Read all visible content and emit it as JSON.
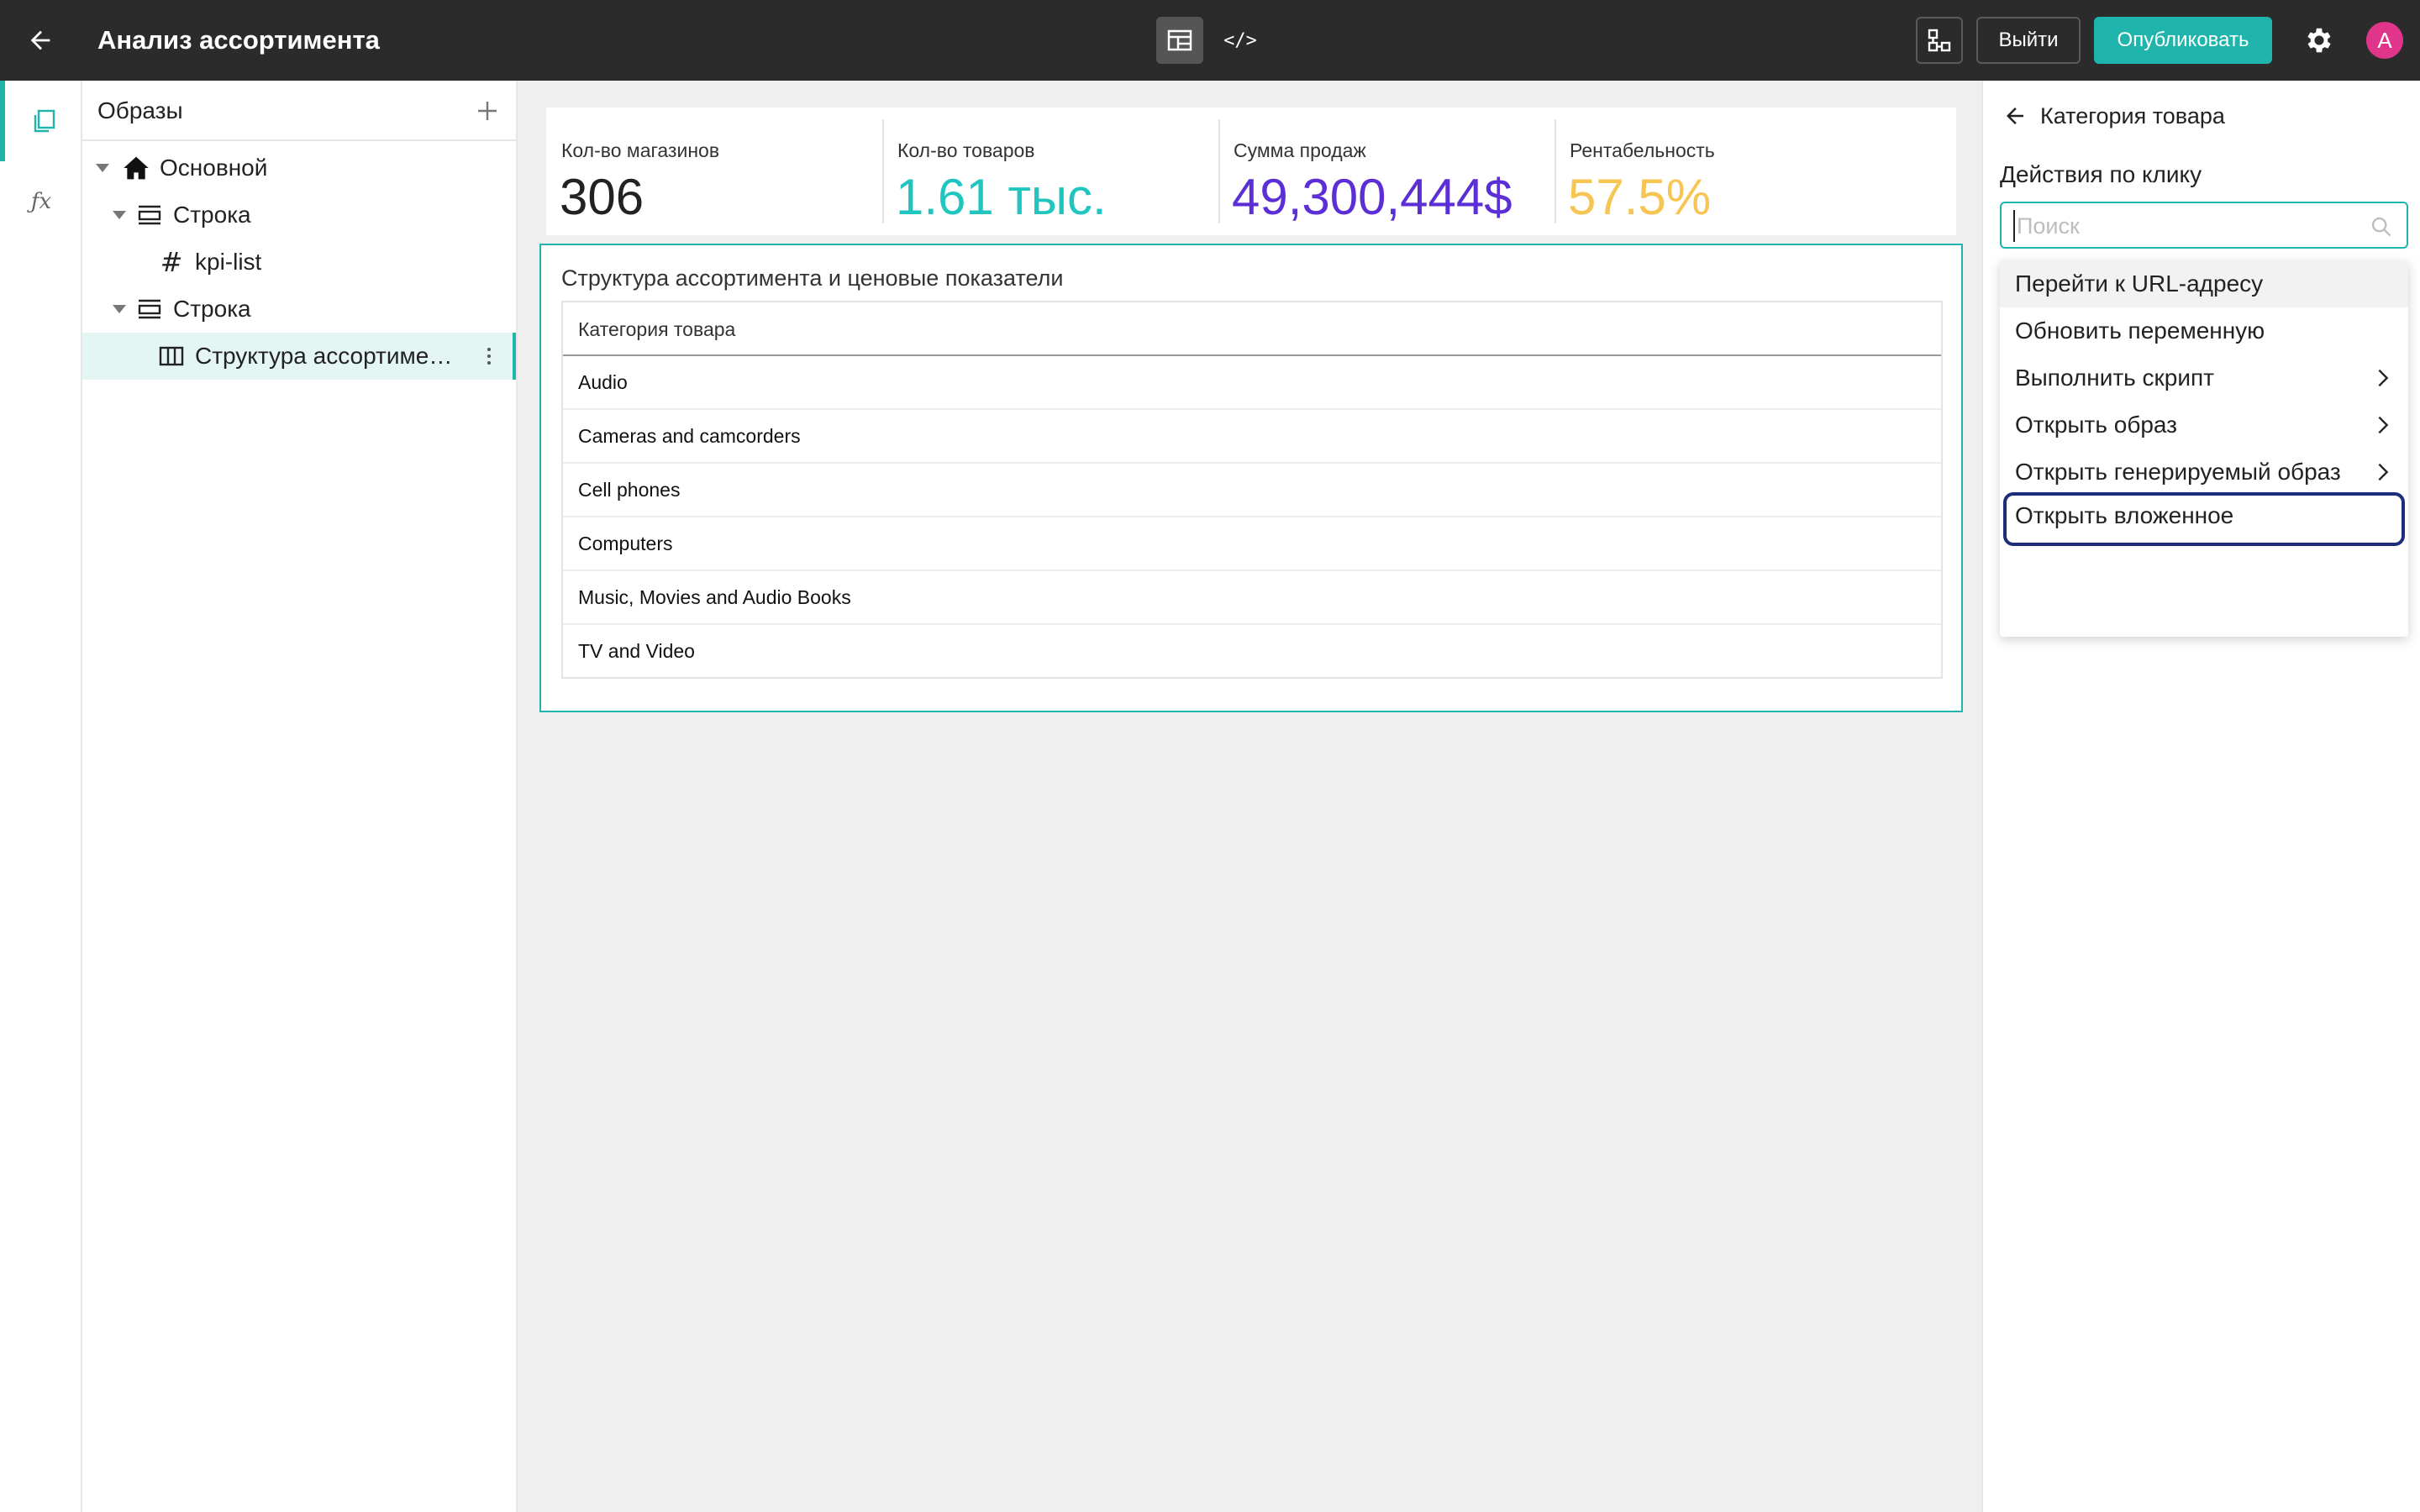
{
  "app": {
    "title": "Анализ ассортимента"
  },
  "toolbar": {
    "exit_label": "Выйти",
    "publish_label": "Опубликовать",
    "code_glyph": "</>",
    "avatar_letter": "A"
  },
  "colors": {
    "accent": "#1fb5ad",
    "topbar": "#2b2b2b",
    "avatar": "#e0358b",
    "focus_ring": "#1c2e7a"
  },
  "rail": {
    "fx_label": "ƒx"
  },
  "tree": {
    "header": "Образы",
    "items": [
      {
        "label": "Основной",
        "icon": "home-icon"
      },
      {
        "label": "Строка",
        "icon": "row-icon"
      },
      {
        "label": "kpi-list",
        "icon": "hash-icon",
        "glyph": "#"
      },
      {
        "label": "Строка",
        "icon": "row-icon"
      },
      {
        "label": "Структура ассортимен…",
        "icon": "table-icon"
      }
    ]
  },
  "kpis": [
    {
      "label": "Кол-во магазинов",
      "value": "306",
      "color": "#222222"
    },
    {
      "label": "Кол-во товаров",
      "value": "1.61 тыс.",
      "color": "#1fc6c0"
    },
    {
      "label": "Сумма продаж",
      "value": "49,300,444$",
      "color": "#5b2ed6"
    },
    {
      "label": "Рентабельность",
      "value": "57.5%",
      "color": "#f7c552"
    }
  ],
  "table": {
    "title": "Структура ассортимента и ценовые показатели",
    "column": "Категория товара",
    "rows": [
      "Audio",
      "Cameras and camcorders",
      "Cell phones",
      "Computers",
      "Music, Movies and Audio Books",
      "TV and Video"
    ]
  },
  "rpanel": {
    "back_label": "Категория товара",
    "section": "Действия по клику",
    "search_placeholder": "Поиск",
    "search_value": "",
    "actions": [
      {
        "label": "Перейти к URL-адресу",
        "submenu": false
      },
      {
        "label": "Обновить переменную",
        "submenu": false
      },
      {
        "label": "Выполнить скрипт",
        "submenu": true
      },
      {
        "label": "Открыть образ",
        "submenu": true
      },
      {
        "label": "Открыть генерируемый образ",
        "submenu": true
      },
      {
        "label": "Открыть вложенное",
        "submenu": false
      }
    ]
  }
}
